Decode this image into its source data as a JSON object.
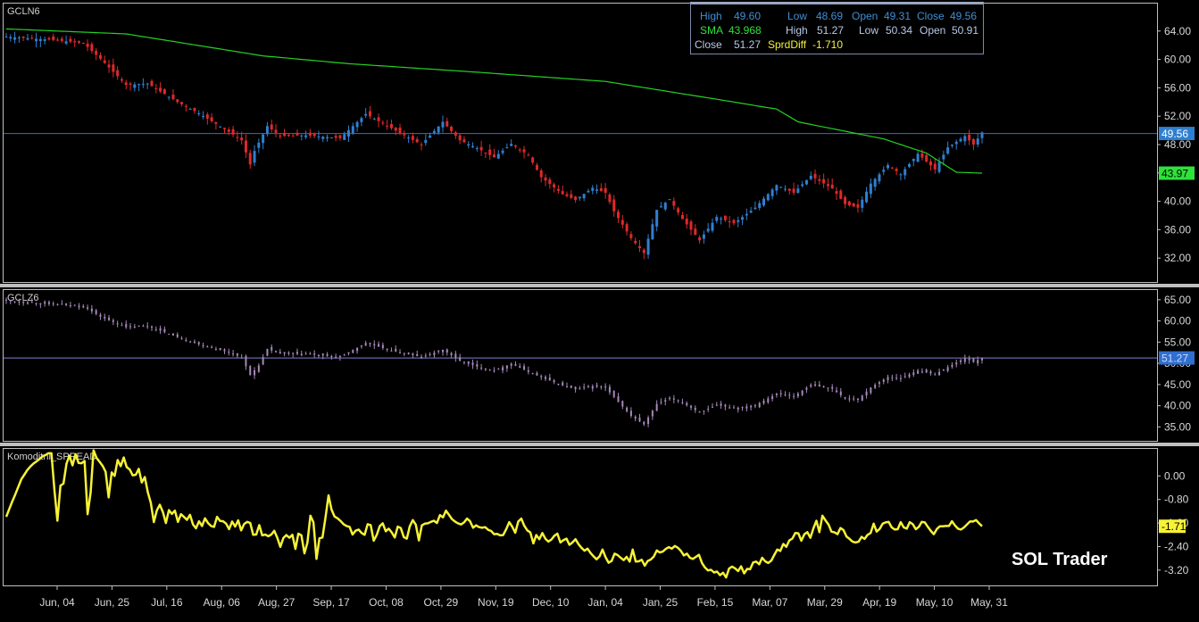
{
  "chart_data": [
    {
      "type": "candlestick",
      "title": "GCLN6",
      "ylim": [
        28.5,
        68
      ],
      "yticks": [
        "64.00",
        "60.00",
        "56.00",
        "52.00",
        "48.00",
        "44.00",
        "40.00",
        "36.00",
        "32.00"
      ],
      "last_price_label": "49.56",
      "last_price": 49.56,
      "sma_label": "43.97",
      "sma_value": 43.97,
      "close_keypoints": [
        [
          0,
          63.2
        ],
        [
          10,
          62.8
        ],
        [
          18,
          62.3
        ],
        [
          22,
          60.1
        ],
        [
          28,
          56.4
        ],
        [
          33,
          56.6
        ],
        [
          40,
          54.0
        ],
        [
          45,
          52.4
        ],
        [
          52,
          49.8
        ],
        [
          55,
          48.6
        ],
        [
          57,
          45.2
        ],
        [
          58,
          47.1
        ],
        [
          61,
          50.6
        ],
        [
          64,
          49.2
        ],
        [
          70,
          49.3
        ],
        [
          78,
          48.9
        ],
        [
          84,
          52.3
        ],
        [
          90,
          50.3
        ],
        [
          97,
          48.0
        ],
        [
          102,
          51.2
        ],
        [
          106,
          48.6
        ],
        [
          110,
          47.5
        ],
        [
          114,
          46.2
        ],
        [
          118,
          48.1
        ],
        [
          122,
          46.5
        ],
        [
          125,
          43.4
        ],
        [
          130,
          41.0
        ],
        [
          133,
          40.2
        ],
        [
          137,
          41.9
        ],
        [
          140,
          41.2
        ],
        [
          142,
          38.6
        ],
        [
          146,
          34.8
        ],
        [
          149,
          32.7
        ],
        [
          152,
          38.8
        ],
        [
          155,
          40.3
        ],
        [
          158,
          37.5
        ],
        [
          162,
          34.5
        ],
        [
          166,
          37.8
        ],
        [
          170,
          36.9
        ],
        [
          175,
          39.1
        ],
        [
          180,
          42.3
        ],
        [
          184,
          41.2
        ],
        [
          188,
          43.6
        ],
        [
          193,
          41.8
        ],
        [
          196,
          39.6
        ],
        [
          199,
          39.1
        ],
        [
          202,
          42.5
        ],
        [
          206,
          45.1
        ],
        [
          209,
          43.8
        ],
        [
          213,
          46.7
        ],
        [
          217,
          44.5
        ],
        [
          220,
          47.6
        ],
        [
          224,
          49.2
        ],
        [
          226,
          48.0
        ],
        [
          228,
          49.7
        ]
      ],
      "sma_keypoints": [
        [
          0,
          64.3
        ],
        [
          28,
          63.6
        ],
        [
          60,
          60.5
        ],
        [
          80,
          59.4
        ],
        [
          110,
          58.2
        ],
        [
          140,
          56.9
        ],
        [
          170,
          54.0
        ],
        [
          180,
          53.0
        ],
        [
          185,
          51.2
        ],
        [
          205,
          48.8
        ],
        [
          215,
          46.8
        ],
        [
          222,
          44.1
        ],
        [
          228,
          43.97
        ]
      ]
    },
    {
      "type": "candlestick",
      "title": "GCLZ6",
      "ylim": [
        31.5,
        67.5
      ],
      "yticks": [
        "65.00",
        "60.00",
        "55.00",
        "50.00",
        "45.00",
        "40.00",
        "35.00"
      ],
      "last_price_label": "51.27",
      "last_price": 51.27,
      "close_keypoints": [
        [
          0,
          64.8
        ],
        [
          10,
          64.0
        ],
        [
          18,
          63.5
        ],
        [
          22,
          61.0
        ],
        [
          28,
          58.5
        ],
        [
          33,
          58.8
        ],
        [
          40,
          56.2
        ],
        [
          45,
          54.5
        ],
        [
          52,
          52.6
        ],
        [
          55,
          51.4
        ],
        [
          57,
          47.2
        ],
        [
          59,
          49.5
        ],
        [
          61,
          53.4
        ],
        [
          64,
          52.3
        ],
        [
          70,
          52.2
        ],
        [
          78,
          51.5
        ],
        [
          84,
          54.8
        ],
        [
          90,
          53.0
        ],
        [
          97,
          51.5
        ],
        [
          102,
          53.2
        ],
        [
          106,
          50.6
        ],
        [
          110,
          49.2
        ],
        [
          114,
          48.3
        ],
        [
          118,
          49.9
        ],
        [
          122,
          48.0
        ],
        [
          125,
          46.7
        ],
        [
          130,
          44.8
        ],
        [
          133,
          43.9
        ],
        [
          137,
          44.6
        ],
        [
          140,
          44.3
        ],
        [
          142,
          42.0
        ],
        [
          146,
          37.6
        ],
        [
          149,
          35.6
        ],
        [
          152,
          40.4
        ],
        [
          155,
          41.8
        ],
        [
          158,
          40.7
        ],
        [
          162,
          38.4
        ],
        [
          166,
          40.2
        ],
        [
          170,
          39.4
        ],
        [
          175,
          40.1
        ],
        [
          180,
          42.8
        ],
        [
          184,
          42.2
        ],
        [
          188,
          44.9
        ],
        [
          193,
          44.0
        ],
        [
          196,
          41.7
        ],
        [
          199,
          41.4
        ],
        [
          202,
          44.3
        ],
        [
          206,
          46.8
        ],
        [
          209,
          46.5
        ],
        [
          213,
          48.3
        ],
        [
          217,
          47.4
        ],
        [
          220,
          49.1
        ],
        [
          224,
          51.2
        ],
        [
          226,
          50.3
        ],
        [
          228,
          51.27
        ]
      ]
    },
    {
      "type": "line",
      "title": "Komoditni_SPREAD",
      "ylim": [
        -3.75,
        0.95
      ],
      "yticks": [
        "0.00",
        "-0.80",
        "-1.60",
        "-2.40",
        "-3.20"
      ],
      "last_value_label": "-1.71",
      "series": [
        {
          "values": [
            -1.39,
            -1.12,
            -0.87,
            -0.63,
            -0.37,
            -0.11,
            0.04,
            0.2,
            0.32,
            0.42,
            0.49,
            0.57,
            0.66,
            0.71,
            0.77,
            0.77,
            -0.49,
            -1.52,
            -0.33,
            -0.26,
            0.42,
            0.69,
            0.36,
            0.74,
            0.44,
            0.43,
            0.51,
            -1.3,
            -0.57,
            0.87,
            0.61,
            0.48,
            0.34,
            0.14,
            -0.73,
            0.12,
            -0.0,
            0.54,
            0.33,
            0.63,
            0.3,
            0.22,
            0.02,
            0.04,
            0.24,
            -0.22,
            -0.04,
            -0.56,
            -0.91,
            -1.57,
            -1.17,
            -0.98,
            -1.22,
            -1.6,
            -1.16,
            -1.29,
            -1.18,
            -1.56,
            -1.3,
            -1.39,
            -1.49,
            -1.32,
            -1.65,
            -1.78,
            -1.54,
            -1.7,
            -1.44,
            -1.6,
            -1.7,
            -1.73,
            -1.39,
            -1.53,
            -1.54,
            -1.62,
            -1.81,
            -1.55,
            -1.72,
            -1.51,
            -1.85,
            -1.63,
            -1.56,
            -1.6,
            -2.0,
            -1.99,
            -1.67,
            -2.02,
            -1.99,
            -2.05,
            -1.99,
            -1.86,
            -2.1,
            -2.41,
            -2.11,
            -2.01,
            -2.1,
            -2.0,
            -2.48,
            -1.96,
            -2.02,
            -2.63,
            -2.27,
            -1.35,
            -1.58,
            -2.82,
            -2.12,
            -2.09,
            -1.41,
            -0.66,
            -1.14,
            -1.38,
            -1.44,
            -1.53,
            -1.64,
            -1.7,
            -1.73,
            -1.99,
            -1.86,
            -1.82,
            -1.94,
            -2.0,
            -1.64,
            -1.67,
            -2.2,
            -2.01,
            -1.71,
            -1.61,
            -1.88,
            -1.79,
            -1.92,
            -2.09,
            -1.72,
            -1.77,
            -2.08,
            -2.13,
            -1.71,
            -1.5,
            -1.66,
            -2.19,
            -1.68,
            -1.62,
            -1.61,
            -1.56,
            -1.52,
            -1.6,
            -1.33,
            -1.41,
            -1.18,
            -1.32,
            -1.47,
            -1.55,
            -1.61,
            -1.65,
            -1.58,
            -1.45,
            -1.54,
            -1.76,
            -1.68,
            -1.74,
            -1.76,
            -1.74,
            -1.83,
            -1.87,
            -1.98,
            -1.97,
            -2.02,
            -2.01,
            -1.81,
            -1.57,
            -1.72,
            -1.93,
            -1.55,
            -1.45,
            -1.69,
            -1.85,
            -1.92,
            -2.29,
            -2.01,
            -2.15,
            -1.94,
            -2.13,
            -2.23,
            -2.16,
            -2.03,
            -1.96,
            -2.26,
            -2.18,
            -2.13,
            -2.34,
            -2.26,
            -2.15,
            -2.32,
            -2.44,
            -2.54,
            -2.47,
            -2.62,
            -2.73,
            -2.83,
            -2.73,
            -2.5,
            -2.76,
            -2.95,
            -2.89,
            -2.64,
            -2.69,
            -2.78,
            -2.86,
            -2.75,
            -2.91,
            -2.5,
            -2.91,
            -2.9,
            -2.85,
            -3.05,
            -2.89,
            -2.84,
            -2.74,
            -2.53,
            -2.6,
            -2.57,
            -2.48,
            -2.42,
            -2.47,
            -2.38,
            -2.44,
            -2.55,
            -2.7,
            -2.64,
            -2.78,
            -2.82,
            -2.75,
            -2.68,
            -2.96,
            -3.11,
            -3.21,
            -3.19,
            -3.28,
            -3.25,
            -3.37,
            -3.29,
            -3.45,
            -3.15,
            -3.08,
            -3.14,
            -3.23,
            -3.07,
            -3.31,
            -3.16,
            -3.17,
            -2.94,
            -2.91,
            -3.0,
            -2.78,
            -2.9,
            -2.96,
            -2.88,
            -2.69,
            -2.5,
            -2.55,
            -2.31,
            -2.41,
            -2.19,
            -2.13,
            -1.94,
            -1.95,
            -2.2,
            -1.98,
            -1.91,
            -2.1,
            -1.78,
            -1.52,
            -1.91,
            -1.35,
            -1.51,
            -1.65,
            -1.89,
            -1.92,
            -1.98,
            -1.77,
            -1.84,
            -2.06,
            -2.14,
            -2.23,
            -2.26,
            -2.23,
            -2.07,
            -2.14,
            -2.0,
            -1.94,
            -1.62,
            -1.89,
            -1.8,
            -1.62,
            -1.58,
            -1.56,
            -1.75,
            -1.82,
            -1.81,
            -1.57,
            -1.75,
            -1.79,
            -1.57,
            -1.64,
            -1.81,
            -1.73,
            -1.56,
            -1.58,
            -1.73,
            -1.87,
            -1.98,
            -1.8,
            -1.71,
            -1.71,
            -1.7,
            -1.7,
            -1.54,
            -1.68,
            -1.79,
            -1.82,
            -1.75,
            -1.65,
            -1.55,
            -1.55,
            -1.5,
            -1.61,
            -1.71
          ]
        }
      ]
    }
  ],
  "x_axis": {
    "tick_labels": [
      "Jun, 04",
      "Jun, 25",
      "Jul, 16",
      "Aug, 06",
      "Aug, 27",
      "Sep, 17",
      "Oct, 08",
      "Oct, 29",
      "Nov, 19",
      "Dec, 10",
      "Jan, 04",
      "Jan, 25",
      "Feb, 15",
      "Mar, 07",
      "Mar, 29",
      "Apr, 19",
      "May, 10",
      "May, 31"
    ]
  },
  "info_box": {
    "row1": {
      "high_label": "High",
      "high_value": "49.60",
      "low_label": "Low",
      "low_value": "48.69",
      "open_label": "Open",
      "open_value": "49.31",
      "close_label": "Close",
      "close_value": "49.56"
    },
    "row2": {
      "sma_label": "SMA",
      "sma_value": "43.968",
      "high_label": "High",
      "high_value": "51.27",
      "low_label": "Low",
      "low_value": "50.34",
      "open_label": "Open",
      "open_value": "50.91"
    },
    "row3": {
      "close_label": "Close",
      "close_value": "51.27",
      "sprd_label": "SprdDiff",
      "sprd_value": "-1.710"
    }
  },
  "watermark": "SOL Trader",
  "colors": {
    "up_candle": "#2f7fd0",
    "down_candle": "#e0282a",
    "sma_line": "#25d125",
    "price_line": "#2f6fd0",
    "z6_candle": "#a58ab8",
    "z6_price_line": "#7f7fd0",
    "spread_line": "#f7f236",
    "label_green": "#2ee23a",
    "label_blue": "#2f7fd0",
    "label_yellow": "#f7f236",
    "separator": "#bfbfbf"
  }
}
